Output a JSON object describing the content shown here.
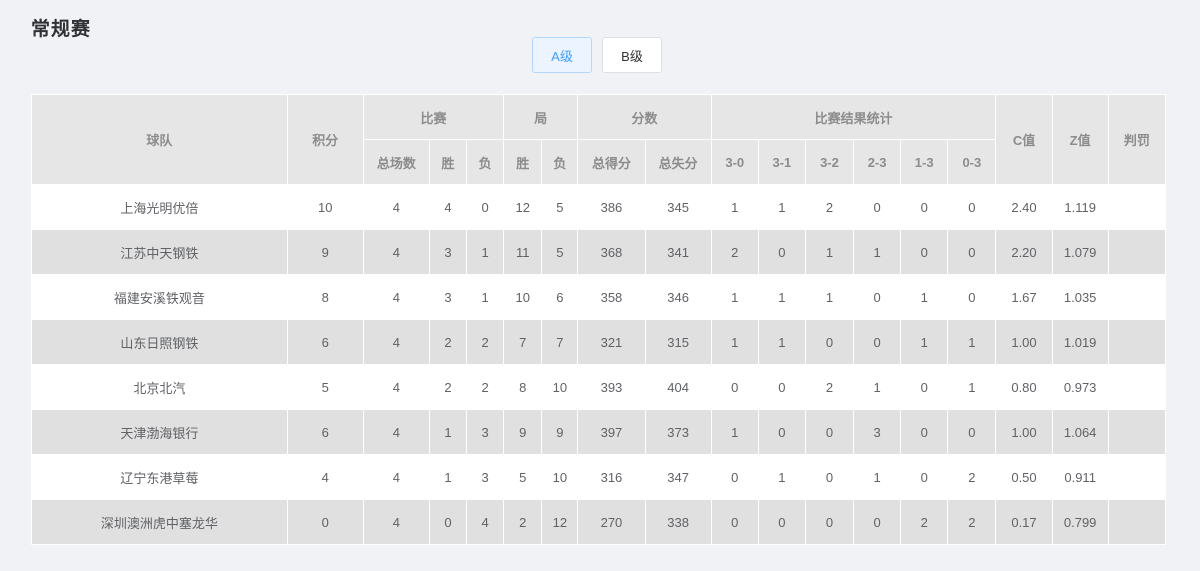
{
  "page": {
    "title": "常规赛"
  },
  "levels": [
    {
      "label": "A级",
      "active": true
    },
    {
      "label": "B级",
      "active": false
    }
  ],
  "table": {
    "group_headers": {
      "team": "球队",
      "points": "积分",
      "matches": "比赛",
      "sets": "局",
      "scores": "分数",
      "result_stats": "比赛结果统计",
      "c_value": "C值",
      "z_value": "Z值",
      "penalty": "判罚"
    },
    "sub_headers": {
      "total_matches": "总场数",
      "match_win": "胜",
      "match_loss": "负",
      "set_win": "胜",
      "set_loss": "负",
      "total_scored": "总得分",
      "total_conceded": "总失分",
      "r30": "3-0",
      "r31": "3-1",
      "r32": "3-2",
      "r23": "2-3",
      "r13": "1-3",
      "r03": "0-3"
    },
    "rows": [
      {
        "team": "上海光明优倍",
        "points": "10",
        "total": "4",
        "win": "4",
        "loss": "0",
        "set_win": "12",
        "set_loss": "5",
        "scored": "386",
        "conceded": "345",
        "r30": "1",
        "r31": "1",
        "r32": "2",
        "r23": "0",
        "r13": "0",
        "r03": "0",
        "c": "2.40",
        "z": "1.119",
        "penalty": ""
      },
      {
        "team": "江苏中天钢铁",
        "points": "9",
        "total": "4",
        "win": "3",
        "loss": "1",
        "set_win": "11",
        "set_loss": "5",
        "scored": "368",
        "conceded": "341",
        "r30": "2",
        "r31": "0",
        "r32": "1",
        "r23": "1",
        "r13": "0",
        "r03": "0",
        "c": "2.20",
        "z": "1.079",
        "penalty": ""
      },
      {
        "team": "福建安溪铁观音",
        "points": "8",
        "total": "4",
        "win": "3",
        "loss": "1",
        "set_win": "10",
        "set_loss": "6",
        "scored": "358",
        "conceded": "346",
        "r30": "1",
        "r31": "1",
        "r32": "1",
        "r23": "0",
        "r13": "1",
        "r03": "0",
        "c": "1.67",
        "z": "1.035",
        "penalty": ""
      },
      {
        "team": "山东日照钢铁",
        "points": "6",
        "total": "4",
        "win": "2",
        "loss": "2",
        "set_win": "7",
        "set_loss": "7",
        "scored": "321",
        "conceded": "315",
        "r30": "1",
        "r31": "1",
        "r32": "0",
        "r23": "0",
        "r13": "1",
        "r03": "1",
        "c": "1.00",
        "z": "1.019",
        "penalty": ""
      },
      {
        "team": "北京北汽",
        "points": "5",
        "total": "4",
        "win": "2",
        "loss": "2",
        "set_win": "8",
        "set_loss": "10",
        "scored": "393",
        "conceded": "404",
        "r30": "0",
        "r31": "0",
        "r32": "2",
        "r23": "1",
        "r13": "0",
        "r03": "1",
        "c": "0.80",
        "z": "0.973",
        "penalty": ""
      },
      {
        "team": "天津渤海银行",
        "points": "6",
        "total": "4",
        "win": "1",
        "loss": "3",
        "set_win": "9",
        "set_loss": "9",
        "scored": "397",
        "conceded": "373",
        "r30": "1",
        "r31": "0",
        "r32": "0",
        "r23": "3",
        "r13": "0",
        "r03": "0",
        "c": "1.00",
        "z": "1.064",
        "penalty": ""
      },
      {
        "team": "辽宁东港草莓",
        "points": "4",
        "total": "4",
        "win": "1",
        "loss": "3",
        "set_win": "5",
        "set_loss": "10",
        "scored": "316",
        "conceded": "347",
        "r30": "0",
        "r31": "1",
        "r32": "0",
        "r23": "1",
        "r13": "0",
        "r03": "2",
        "c": "0.50",
        "z": "0.911",
        "penalty": ""
      },
      {
        "team": "深圳澳洲虎中塞龙华",
        "points": "0",
        "total": "4",
        "win": "0",
        "loss": "4",
        "set_win": "2",
        "set_loss": "12",
        "scored": "270",
        "conceded": "338",
        "r30": "0",
        "r31": "0",
        "r32": "0",
        "r23": "0",
        "r13": "2",
        "r03": "2",
        "c": "0.17",
        "z": "0.799",
        "penalty": ""
      }
    ]
  }
}
